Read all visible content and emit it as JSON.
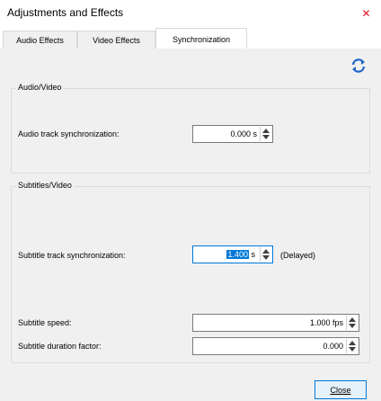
{
  "window": {
    "title": "Adjustments and Effects",
    "close_glyph": "✕"
  },
  "tabs": [
    {
      "label": "Audio Effects"
    },
    {
      "label": "Video Effects"
    },
    {
      "label": "Synchronization",
      "active": true
    }
  ],
  "toolbar": {
    "icon": "refresh-sync-icon",
    "accent_color": "#1e64c8"
  },
  "audio_video": {
    "group_title": "Audio/Video",
    "audio_sync_label": "Audio track synchronization:",
    "audio_sync_value": "0.000 s"
  },
  "subtitles_video": {
    "group_title": "Subtitles/Video",
    "subtitle_sync_label": "Subtitle track synchronization:",
    "subtitle_sync_selected": "1.400",
    "subtitle_sync_unit": " s",
    "subtitle_sync_status": "(Delayed)",
    "subtitle_speed_label": "Subtitle speed:",
    "subtitle_speed_value": "1.000 fps",
    "subtitle_duration_label": "Subtitle duration factor:",
    "subtitle_duration_value": "0.000"
  },
  "footer": {
    "close_label": "Close"
  }
}
